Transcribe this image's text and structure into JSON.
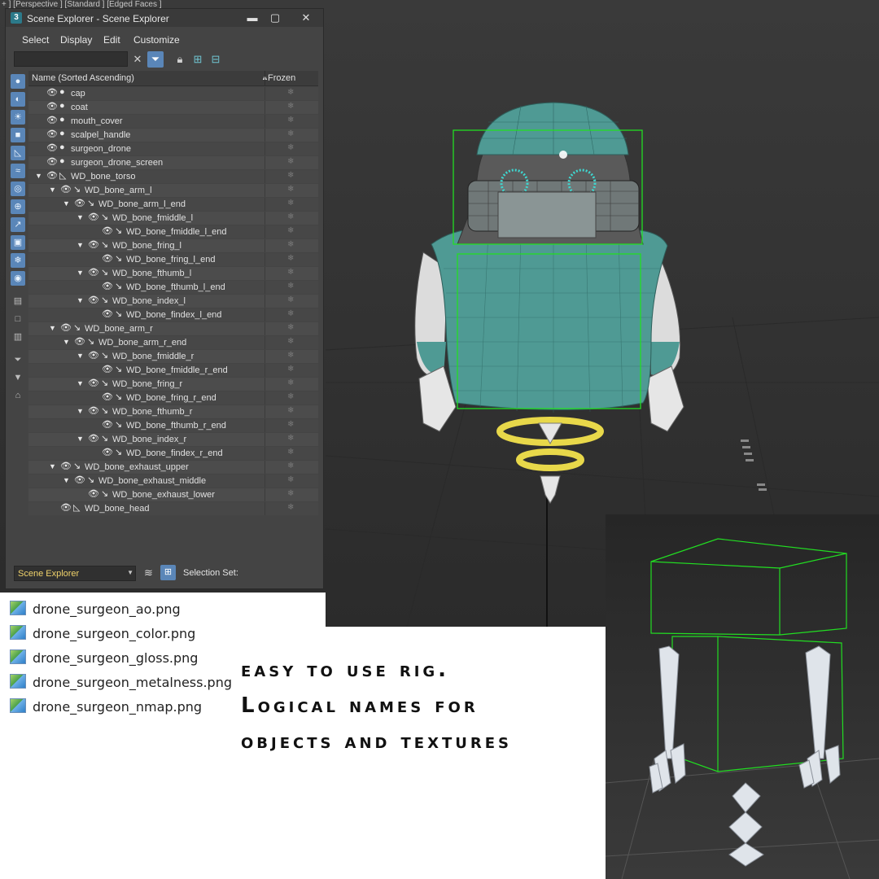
{
  "viewport": {
    "label": "+ ] [Perspective ] [Standard ] [Edged Faces ]"
  },
  "scene_explorer": {
    "app_icon": "3",
    "title": "Scene Explorer - Scene Explorer",
    "window_buttons": [
      "▬",
      "▢",
      "✕"
    ],
    "menu": [
      "Select",
      "Display",
      "Edit",
      "Customize"
    ],
    "toolbar_icons": [
      "clear-search-icon",
      "filter-icon",
      "lock-icon",
      "hierarchy-icon",
      "hierarchy-alt-icon"
    ],
    "left_toolbar_icons": [
      "geometry-filter-icon",
      "shape-filter-icon",
      "light-filter-icon",
      "camera-filter-icon",
      "helper-filter-icon",
      "spacewarp-filter-icon",
      "group-filter-icon",
      "xref-filter-icon",
      "bone-filter-icon",
      "container-filter-icon",
      "frozen-filter-icon",
      "hidden-filter-icon",
      "all-icon",
      "none-icon",
      "invert-icon",
      "filter-off-icon",
      "filter-on-icon",
      "options-icon"
    ],
    "columns": {
      "name": "Name (Sorted Ascending)",
      "sort_arrow": "▲",
      "frozen": "Frozen"
    },
    "rows": [
      {
        "label": "cap",
        "depth": 0,
        "exp": "",
        "type": "object"
      },
      {
        "label": "coat",
        "depth": 0,
        "exp": "",
        "type": "object"
      },
      {
        "label": "mouth_cover",
        "depth": 0,
        "exp": "",
        "type": "object"
      },
      {
        "label": "scalpel_handle",
        "depth": 0,
        "exp": "",
        "type": "object"
      },
      {
        "label": "surgeon_drone",
        "depth": 0,
        "exp": "",
        "type": "object"
      },
      {
        "label": "surgeon_drone_screen",
        "depth": 0,
        "exp": "",
        "type": "object"
      },
      {
        "label": "WD_bone_torso",
        "depth": 0,
        "exp": "▼",
        "type": "bone-root"
      },
      {
        "label": "WD_bone_arm_l",
        "depth": 1,
        "exp": "▼",
        "type": "bone"
      },
      {
        "label": "WD_bone_arm_l_end",
        "depth": 2,
        "exp": "▼",
        "type": "bone"
      },
      {
        "label": "WD_bone_fmiddle_l",
        "depth": 3,
        "exp": "▼",
        "type": "bone"
      },
      {
        "label": "WD_bone_fmiddle_l_end",
        "depth": 4,
        "exp": "",
        "type": "bone"
      },
      {
        "label": "WD_bone_fring_l",
        "depth": 3,
        "exp": "▼",
        "type": "bone"
      },
      {
        "label": "WD_bone_fring_l_end",
        "depth": 4,
        "exp": "",
        "type": "bone"
      },
      {
        "label": "WD_bone_fthumb_l",
        "depth": 3,
        "exp": "▼",
        "type": "bone"
      },
      {
        "label": "WD_bone_fthumb_l_end",
        "depth": 4,
        "exp": "",
        "type": "bone"
      },
      {
        "label": "WD_bone_index_l",
        "depth": 3,
        "exp": "▼",
        "type": "bone"
      },
      {
        "label": "WD_bone_findex_l_end",
        "depth": 4,
        "exp": "",
        "type": "bone"
      },
      {
        "label": "WD_bone_arm_r",
        "depth": 1,
        "exp": "▼",
        "type": "bone"
      },
      {
        "label": "WD_bone_arm_r_end",
        "depth": 2,
        "exp": "▼",
        "type": "bone"
      },
      {
        "label": "WD_bone_fmiddle_r",
        "depth": 3,
        "exp": "▼",
        "type": "bone"
      },
      {
        "label": "WD_bone_fmiddle_r_end",
        "depth": 4,
        "exp": "",
        "type": "bone"
      },
      {
        "label": "WD_bone_fring_r",
        "depth": 3,
        "exp": "▼",
        "type": "bone"
      },
      {
        "label": "WD_bone_fring_r_end",
        "depth": 4,
        "exp": "",
        "type": "bone"
      },
      {
        "label": "WD_bone_fthumb_r",
        "depth": 3,
        "exp": "▼",
        "type": "bone"
      },
      {
        "label": "WD_bone_fthumb_r_end",
        "depth": 4,
        "exp": "",
        "type": "bone"
      },
      {
        "label": "WD_bone_index_r",
        "depth": 3,
        "exp": "▼",
        "type": "bone"
      },
      {
        "label": "WD_bone_findex_r_end",
        "depth": 4,
        "exp": "",
        "type": "bone"
      },
      {
        "label": "WD_bone_exhaust_upper",
        "depth": 1,
        "exp": "▼",
        "type": "bone"
      },
      {
        "label": "WD_bone_exhaust_middle",
        "depth": 2,
        "exp": "▼",
        "type": "bone"
      },
      {
        "label": "WD_bone_exhaust_lower",
        "depth": 3,
        "exp": "",
        "type": "bone"
      },
      {
        "label": "WD_bone_head",
        "depth": 1,
        "exp": "",
        "type": "bone-root"
      }
    ],
    "frozen_glyph": "❄",
    "status": {
      "dropdown_value": "Scene Explorer",
      "dropdown_arrow": "▼",
      "selection_set_label": "Selection Set:",
      "collapse_glyph": "»"
    }
  },
  "files": [
    "drone_surgeon_ao.png",
    "drone_surgeon_color.png",
    "drone_surgeon_gloss.png",
    "drone_surgeon_metalness.png",
    "drone_surgeon_nmap.png"
  ],
  "caption": [
    "easy to use rig.",
    "Logical names for",
    "objects and textures"
  ],
  "colors": {
    "panel_bg": "#444444",
    "selection_blue": "#5a86b8",
    "dropdown_text": "#f1d36b",
    "model_teal": "#4f9a94",
    "bbox_green": "#22dd22",
    "ring_yellow": "#e8d84a",
    "viewport_bg": "#333333"
  }
}
